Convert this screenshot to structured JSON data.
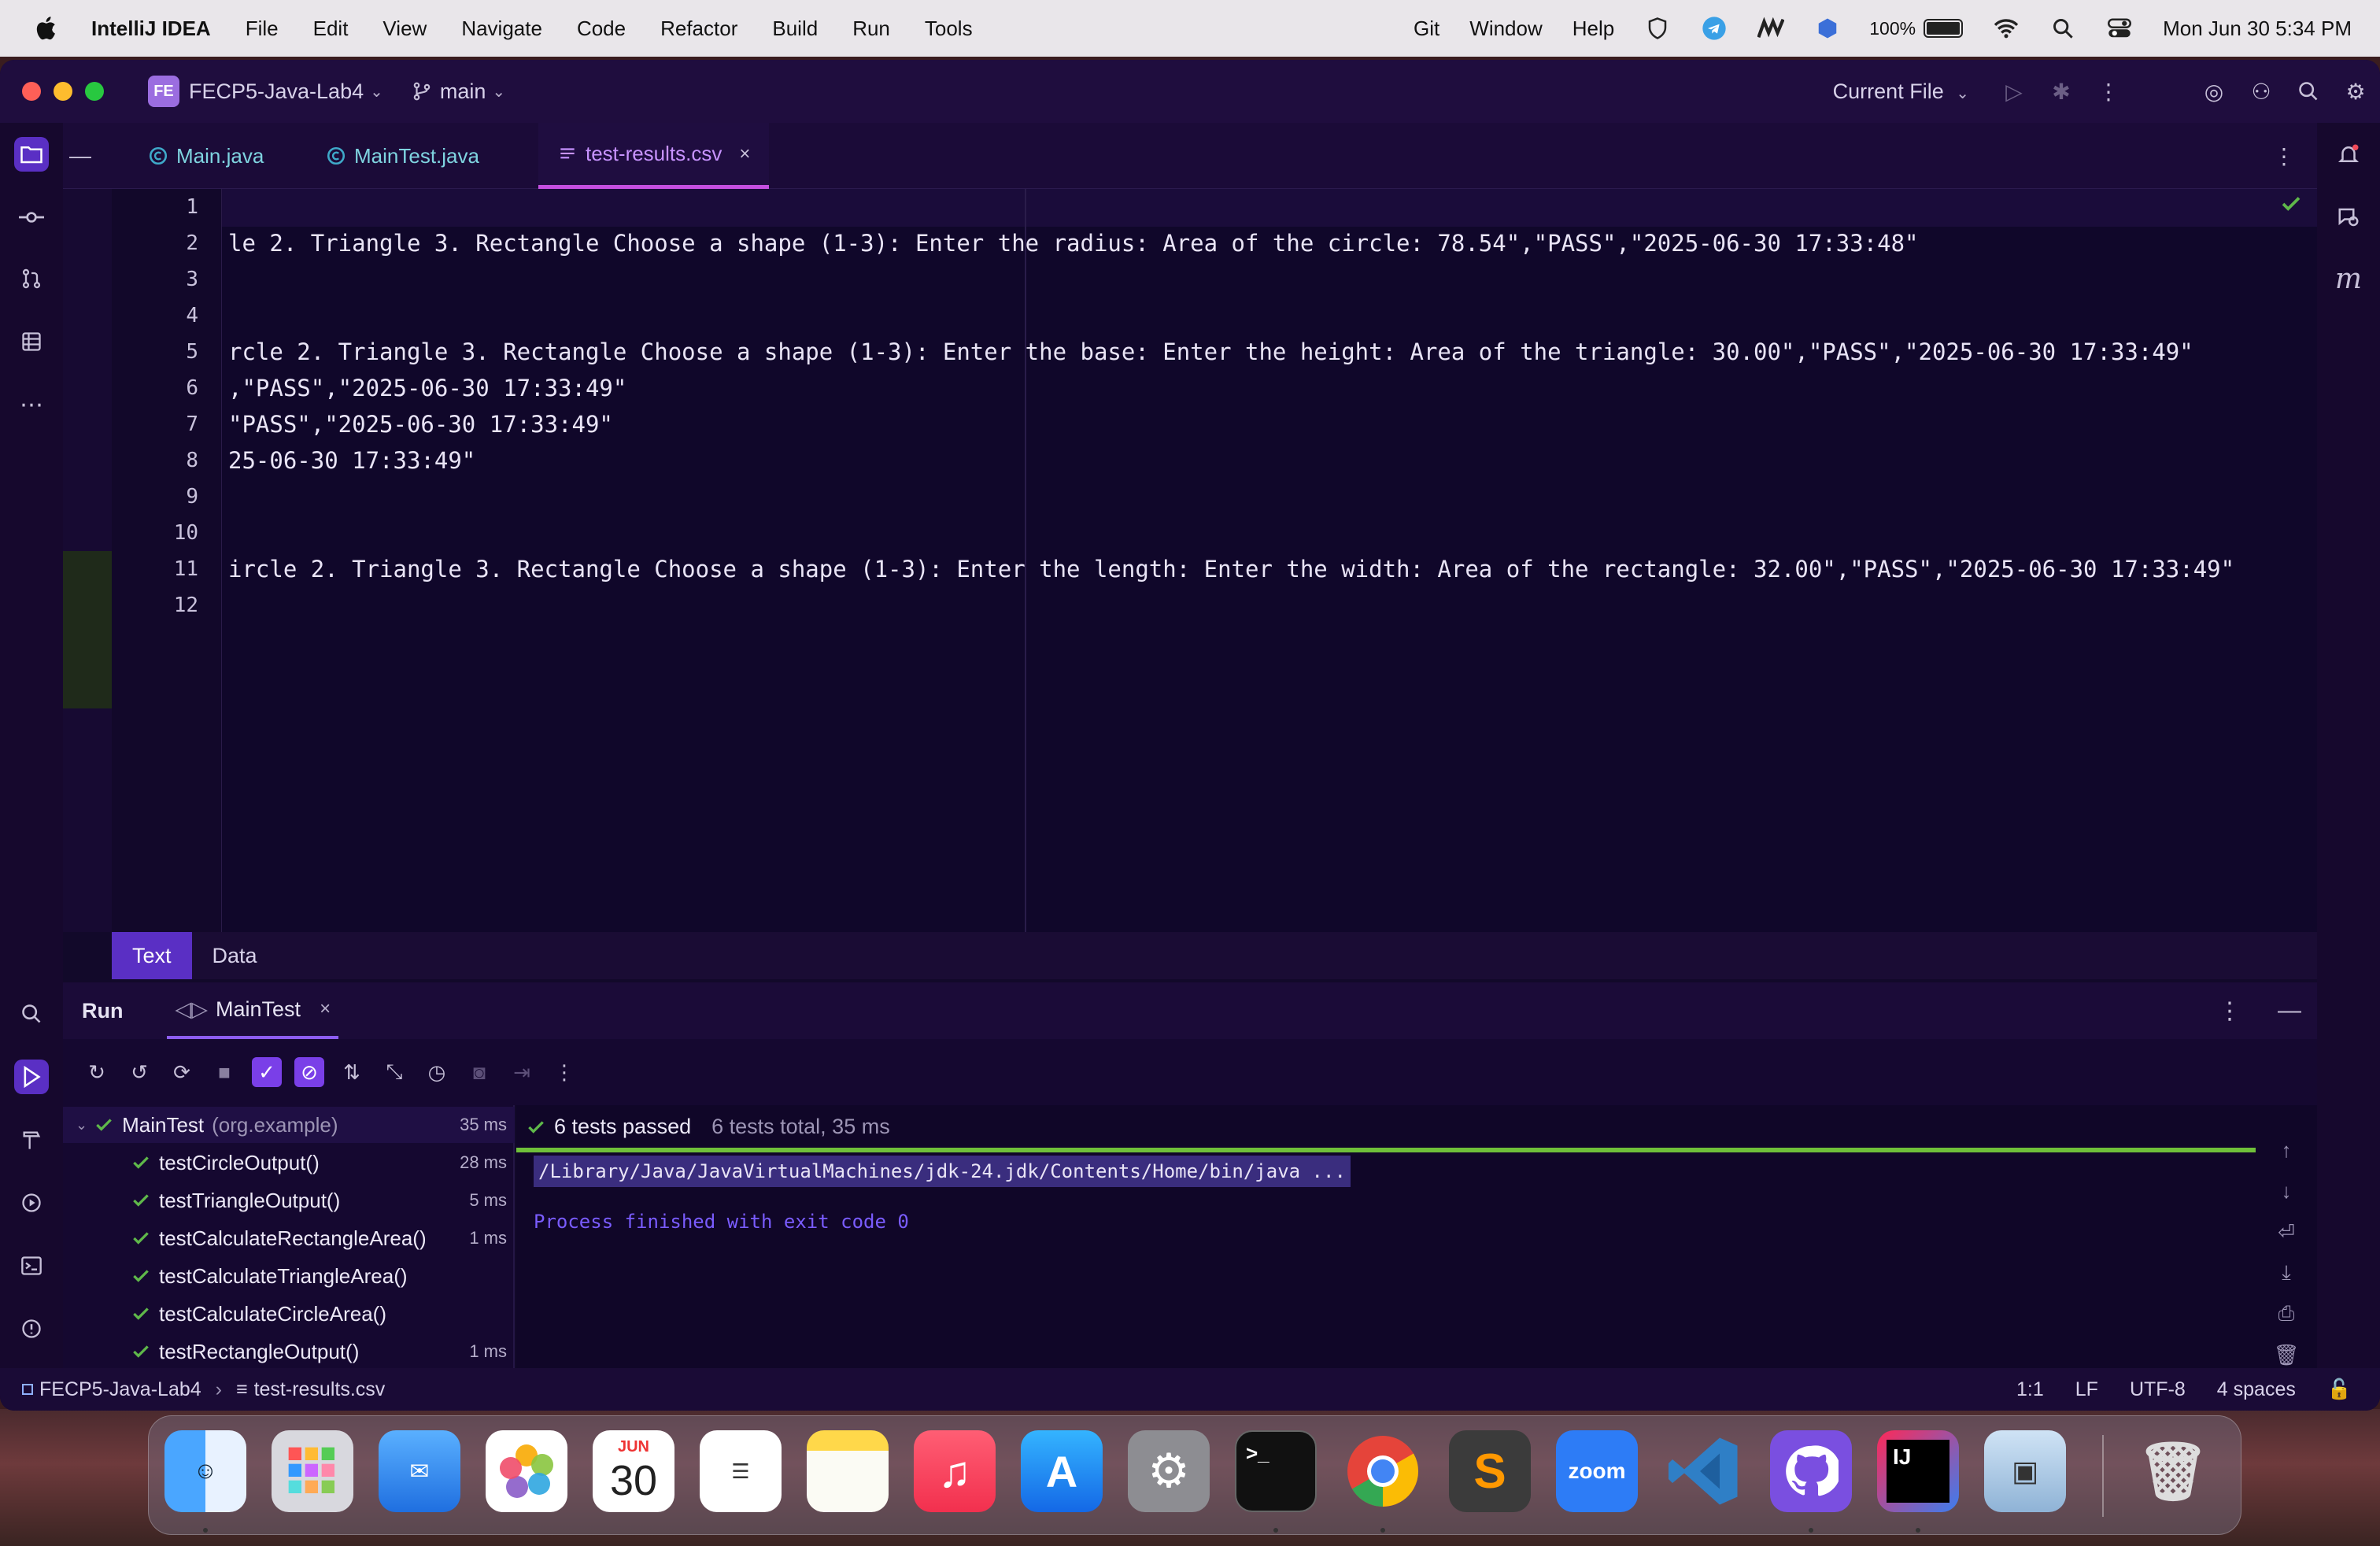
{
  "menubar": {
    "app_name": "IntelliJ IDEA",
    "items": [
      "File",
      "Edit",
      "View",
      "Navigate",
      "Code",
      "Refactor",
      "Build",
      "Run",
      "Tools"
    ],
    "right_items": [
      "Git",
      "Window",
      "Help"
    ],
    "battery": "100%",
    "datetime": "Mon Jun 30  5:34 PM"
  },
  "titlebar": {
    "project_badge": "FE",
    "project_name": "FECP5-Java-Lab4",
    "branch": "main",
    "run_config": "Current File"
  },
  "tabs": [
    {
      "label": "Main.java",
      "active": false
    },
    {
      "label": "MainTest.java",
      "active": false
    },
    {
      "label": "test-results.csv",
      "active": true
    }
  ],
  "editor": {
    "line_numbers": [
      "1",
      "2",
      "3",
      "4",
      "5",
      "6",
      "7",
      "8",
      "9",
      "10",
      "11",
      "12"
    ],
    "lines": [
      "",
      "le 2. Triangle 3. Rectangle Choose a shape (1-3): Enter the radius: Area of the circle: 78.54\",\"PASS\",\"2025-06-30 17:33:48\"",
      "",
      "",
      "rcle 2. Triangle 3. Rectangle Choose a shape (1-3): Enter the base: Enter the height: Area of the triangle: 30.00\",\"PASS\",\"2025-06-30 17:33:49\"",
      ",\"PASS\",\"2025-06-30 17:33:49\"",
      "\"PASS\",\"2025-06-30 17:33:49\"",
      "25-06-30 17:33:49\"",
      "",
      "",
      "ircle 2. Triangle 3. Rectangle Choose a shape (1-3): Enter the length: Enter the width: Area of the rectangle: 32.00\",\"PASS\",\"2025-06-30 17:33:49\"",
      ""
    ],
    "view_tabs": [
      "Text",
      "Data"
    ]
  },
  "run": {
    "title": "Run",
    "tab_label": "MainTest",
    "tree": [
      {
        "name": "MainTest",
        "pkg": "(org.example)",
        "time": "35 ms",
        "root": true
      },
      {
        "name": "testCircleOutput()",
        "time": "28 ms"
      },
      {
        "name": "testTriangleOutput()",
        "time": "5 ms"
      },
      {
        "name": "testCalculateRectangleArea()",
        "time": "1 ms"
      },
      {
        "name": "testCalculateTriangleArea()",
        "time": ""
      },
      {
        "name": "testCalculateCircleArea()",
        "time": ""
      },
      {
        "name": "testRectangleOutput()",
        "time": "1 ms"
      }
    ],
    "summary_passed": "6 tests passed",
    "summary_total": "6 tests total, 35 ms",
    "command": "/Library/Java/JavaVirtualMachines/jdk-24.jdk/Contents/Home/bin/java ...",
    "exit_message": "Process finished with exit code 0"
  },
  "statusbar": {
    "project": "FECP5-Java-Lab4",
    "file": "test-results.csv",
    "position": "1:1",
    "line_sep": "LF",
    "encoding": "UTF-8",
    "indent": "4 spaces"
  },
  "dock": {
    "calendar_month": "JUN",
    "calendar_day": "30",
    "zoom_label": "zoom",
    "ij_label": "IJ"
  },
  "colors": {
    "accent": "#7a3fe8",
    "pass_green": "#6fbf3a",
    "tab_active": "#c893ff"
  }
}
